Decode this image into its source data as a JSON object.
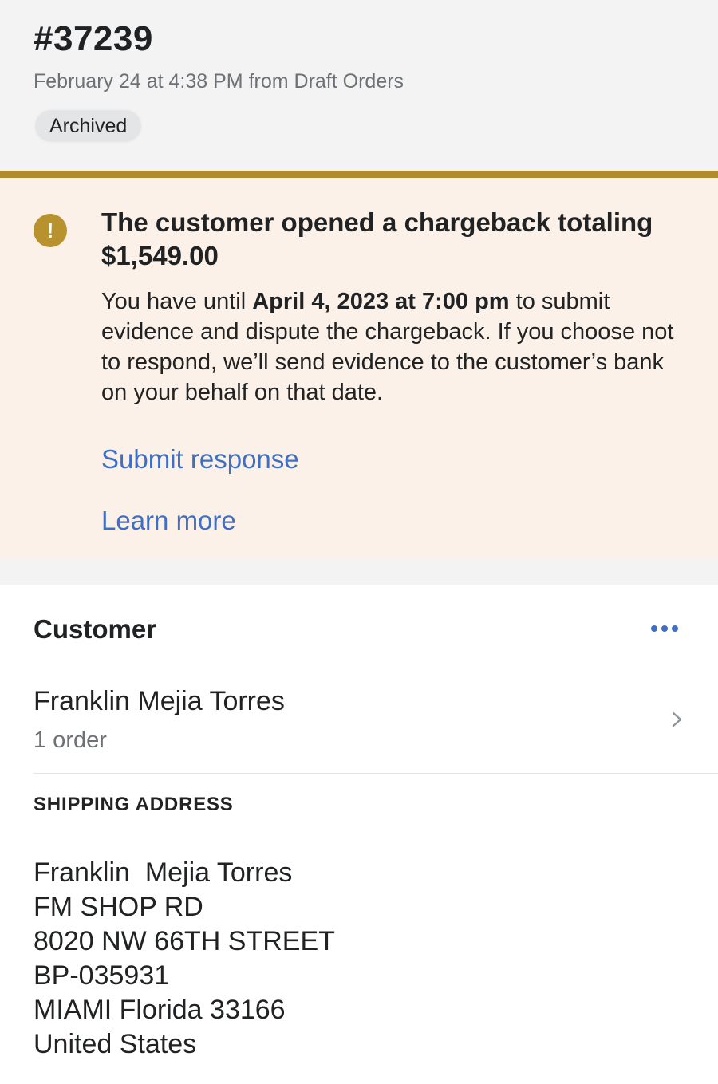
{
  "order": {
    "number": "#37239",
    "meta": "February 24 at 4:38 PM from Draft Orders",
    "status": "Archived"
  },
  "banner": {
    "icon": "exclamation-icon",
    "accent_color": "#b08d2c",
    "title": "The customer opened a chargeback totaling $1,549.00",
    "body_prefix": "You have until ",
    "body_deadline": "April 4, 2023 at 7:00 pm",
    "body_suffix": " to submit evidence and dispute the chargeback. If you choose not to respond, we’ll send evidence to the customer’s bank on your behalf on that date.",
    "submit_label": "Submit response",
    "learn_label": "Learn more",
    "link_color": "#3e6fc4"
  },
  "customer": {
    "title": "Customer",
    "name": "Franklin Mejia Torres",
    "orders": "1 order"
  },
  "shipping": {
    "label": "SHIPPING ADDRESS",
    "lines": [
      "Franklin  Mejia Torres",
      "FM SHOP RD",
      "8020 NW 66TH STREET",
      "BP-035931",
      "MIAMI Florida 33166",
      "United States"
    ]
  }
}
